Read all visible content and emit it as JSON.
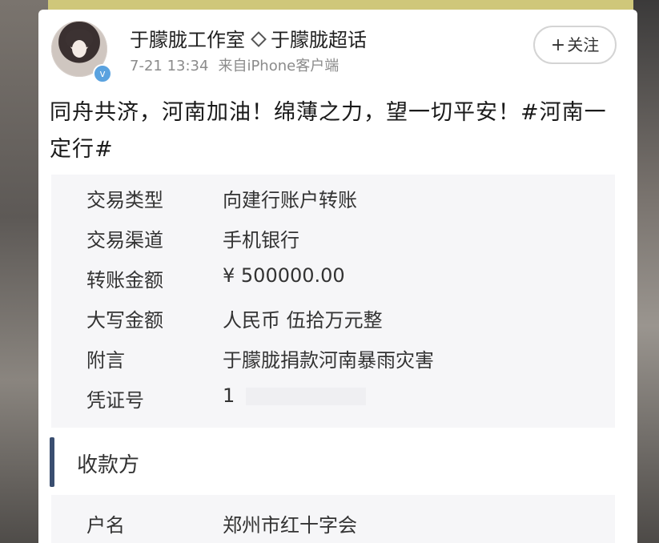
{
  "post": {
    "author": "于朦胧工作室",
    "super_topic": "于朦胧超话",
    "time": "7-21 13:34",
    "source": "来自iPhone客户端",
    "follow_label": "关注",
    "follow_plus": "+",
    "verified_mark": "v",
    "text": "同舟共济，河南加油！绵薄之力，望一切平安！#河南一定行#"
  },
  "transaction": {
    "rows": [
      {
        "label": "交易类型",
        "value": "向建行账户转账"
      },
      {
        "label": "交易渠道",
        "value": "手机银行"
      },
      {
        "label": "转账金额",
        "value": "¥ 500000.00"
      },
      {
        "label": "大写金额",
        "value": "人民币 伍拾万元整"
      },
      {
        "label": "附言",
        "value": "于朦胧捐款河南暴雨灾害"
      },
      {
        "label": "凭证号",
        "value": "1"
      }
    ]
  },
  "payee": {
    "section_title": "收款方",
    "rows": [
      {
        "label": "户名",
        "value": "郑州市红十字会"
      }
    ]
  },
  "icons": {
    "super_topic": "diamond-icon",
    "verified": "verified-badge-icon"
  },
  "colors": {
    "section_accent": "#3a4e70",
    "verified": "#5aa2df"
  }
}
